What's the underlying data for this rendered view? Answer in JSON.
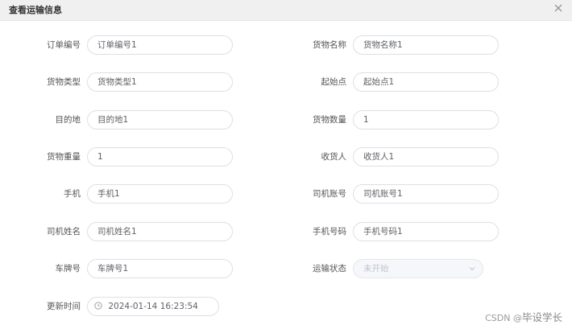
{
  "dialog": {
    "title": "查看运输信息"
  },
  "fields": {
    "order_no": {
      "label": "订单编号",
      "value": "订单编号1"
    },
    "goods_name": {
      "label": "货物名称",
      "value": "货物名称1"
    },
    "goods_type": {
      "label": "货物类型",
      "value": "货物类型1"
    },
    "origin": {
      "label": "起始点",
      "value": "起始点1"
    },
    "destination": {
      "label": "目的地",
      "value": "目的地1"
    },
    "goods_qty": {
      "label": "货物数量",
      "value": "1"
    },
    "goods_weight": {
      "label": "货物重量",
      "value": "1"
    },
    "consignee": {
      "label": "收货人",
      "value": "收货人1"
    },
    "phone": {
      "label": "手机",
      "value": "手机1"
    },
    "driver_account": {
      "label": "司机账号",
      "value": "司机账号1"
    },
    "driver_name": {
      "label": "司机姓名",
      "value": "司机姓名1"
    },
    "phone_number": {
      "label": "手机号码",
      "value": "手机号码1"
    },
    "plate_no": {
      "label": "车牌号",
      "value": "车牌号1"
    },
    "transport_status": {
      "label": "运输状态",
      "value": "未开始"
    },
    "update_time": {
      "label": "更新时间",
      "value": "2024-01-14 16:23:54"
    }
  },
  "watermark": {
    "prefix": "CSDN @",
    "name": "毕设学长"
  },
  "icons": {
    "close": "close-icon",
    "dropdown": "chevron-down-icon",
    "clock": "clock-icon"
  }
}
